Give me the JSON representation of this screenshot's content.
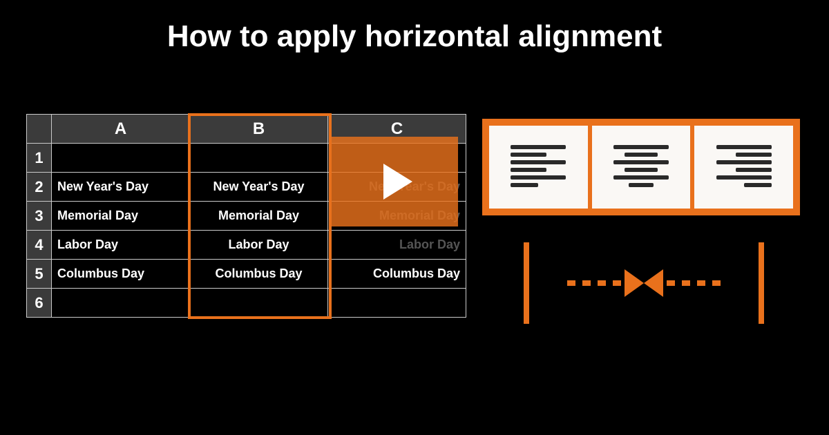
{
  "title": "How to apply horizontal alignment",
  "columns": [
    "A",
    "B",
    "C"
  ],
  "rows": [
    "1",
    "2",
    "3",
    "4",
    "5",
    "6"
  ],
  "cells": {
    "A": [
      "",
      "New Year's Day",
      "Memorial Day",
      "Labor Day",
      "Columbus Day",
      ""
    ],
    "B": [
      "",
      "New Year's Day",
      "Memorial Day",
      "Labor Day",
      "Columbus Day",
      ""
    ],
    "C": [
      "",
      "New Year's Day",
      "Memorial Day",
      "Labor Day",
      "Columbus Day",
      ""
    ]
  },
  "alignments": {
    "left": "align-left-icon",
    "center": "align-center-icon",
    "right": "align-right-icon"
  },
  "accent_color": "#e9711c"
}
